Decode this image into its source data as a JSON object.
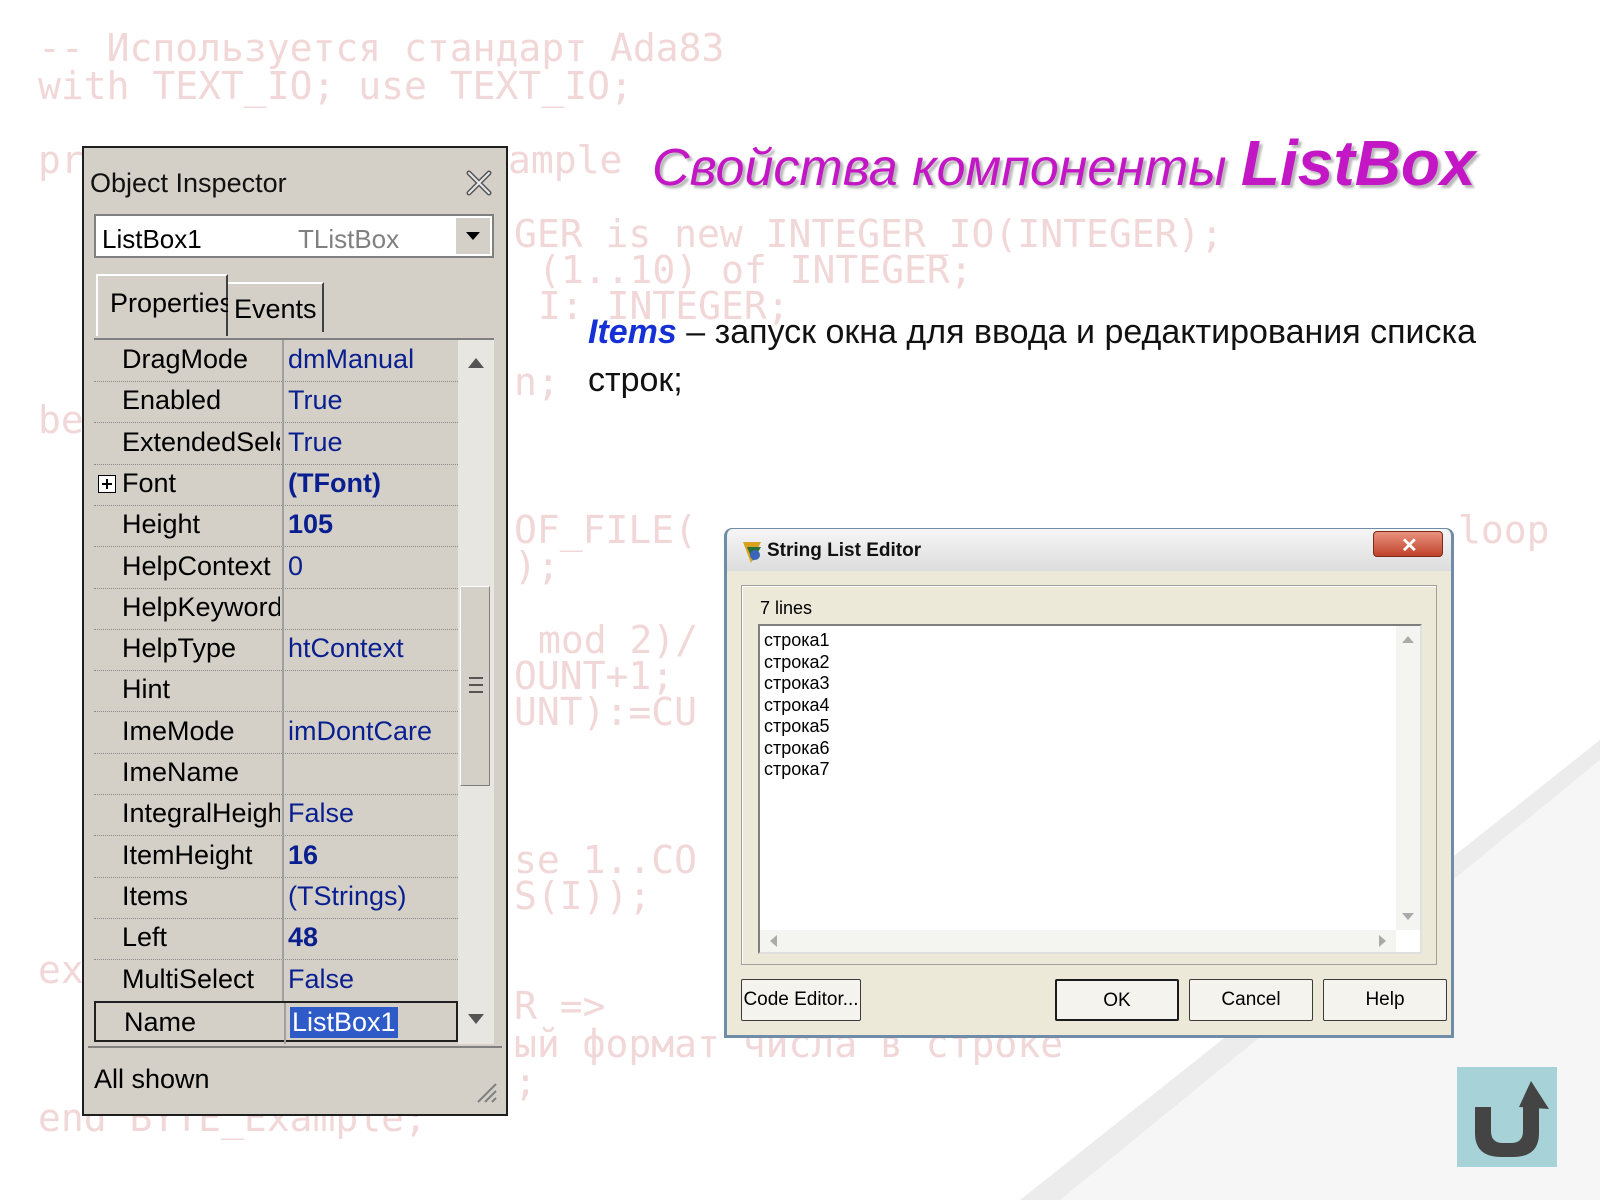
{
  "background_code": [
    "-- Используется стандарт Ada83",
    "with TEXT_IO; use TEXT_IO;",
    "pr",
    "ample",
    "GER is new INTEGER_IO(INTEGER);",
    "(1..10) of INTEGER;",
    "I: INTEGER;",
    "n;",
    "be",
    "OF_FILE(",
    "loop",
    ");",
    "mod 2)/",
    "OUNT+1;",
    "UNT):=CU",
    "se 1..CO",
    "S(I));",
    "ex",
    "R =>",
    "ый формат числа в строке",
    ";",
    "end BYTE_Example;"
  ],
  "slide": {
    "title_prefix": "Свойства компоненты",
    "title_highlight": "ListBox",
    "description_keyword": "Items",
    "description_text": " – запуск окна для ввода и редактирования списка строк;"
  },
  "object_inspector": {
    "title": "Object Inspector",
    "selected_component": "ListBox1",
    "selected_class": "TListBox",
    "tabs": [
      "Properties",
      "Events"
    ],
    "properties": [
      {
        "name": "DragMode",
        "value": "dmManual",
        "bold": false,
        "expandable": false
      },
      {
        "name": "Enabled",
        "value": "True",
        "bold": false,
        "expandable": false
      },
      {
        "name": "ExtendedSelect",
        "value": "True",
        "bold": false,
        "expandable": false
      },
      {
        "name": "Font",
        "value": "(TFont)",
        "bold": true,
        "expandable": true
      },
      {
        "name": "Height",
        "value": "105",
        "bold": true,
        "expandable": false
      },
      {
        "name": "HelpContext",
        "value": "0",
        "bold": false,
        "expandable": false
      },
      {
        "name": "HelpKeyword",
        "value": "",
        "bold": false,
        "expandable": false
      },
      {
        "name": "HelpType",
        "value": "htContext",
        "bold": false,
        "expandable": false
      },
      {
        "name": "Hint",
        "value": "",
        "bold": false,
        "expandable": false
      },
      {
        "name": "ImeMode",
        "value": "imDontCare",
        "bold": false,
        "expandable": false
      },
      {
        "name": "ImeName",
        "value": "",
        "bold": false,
        "expandable": false
      },
      {
        "name": "IntegralHeight",
        "value": "False",
        "bold": false,
        "expandable": false
      },
      {
        "name": "ItemHeight",
        "value": "16",
        "bold": true,
        "expandable": false
      },
      {
        "name": "Items",
        "value": "(TStrings)",
        "bold": false,
        "expandable": false
      },
      {
        "name": "Left",
        "value": "48",
        "bold": true,
        "expandable": false
      },
      {
        "name": "MultiSelect",
        "value": "False",
        "bold": false,
        "expandable": false
      },
      {
        "name": "Name",
        "value": "ListBox1",
        "bold": false,
        "expandable": false,
        "selected": true
      }
    ],
    "status": "All shown"
  },
  "string_list_editor": {
    "title": "String List Editor",
    "line_count": "7 lines",
    "lines": [
      "строка1",
      "строка2",
      "строка3",
      "строка4",
      "строка5",
      "строка6",
      "строка7"
    ],
    "buttons": {
      "code_editor": "Code Editor...",
      "ok": "OK",
      "cancel": "Cancel",
      "help": "Help"
    }
  },
  "icons": {
    "back": "back-arrow-icon",
    "close": "close-icon",
    "app": "delphi-app-icon"
  },
  "colors": {
    "title": "#c317c6",
    "keyword": "#1531d6",
    "property_value": "#0a1f8f",
    "selection": "#2f5bc8",
    "back_button": "#a7d2d7"
  }
}
